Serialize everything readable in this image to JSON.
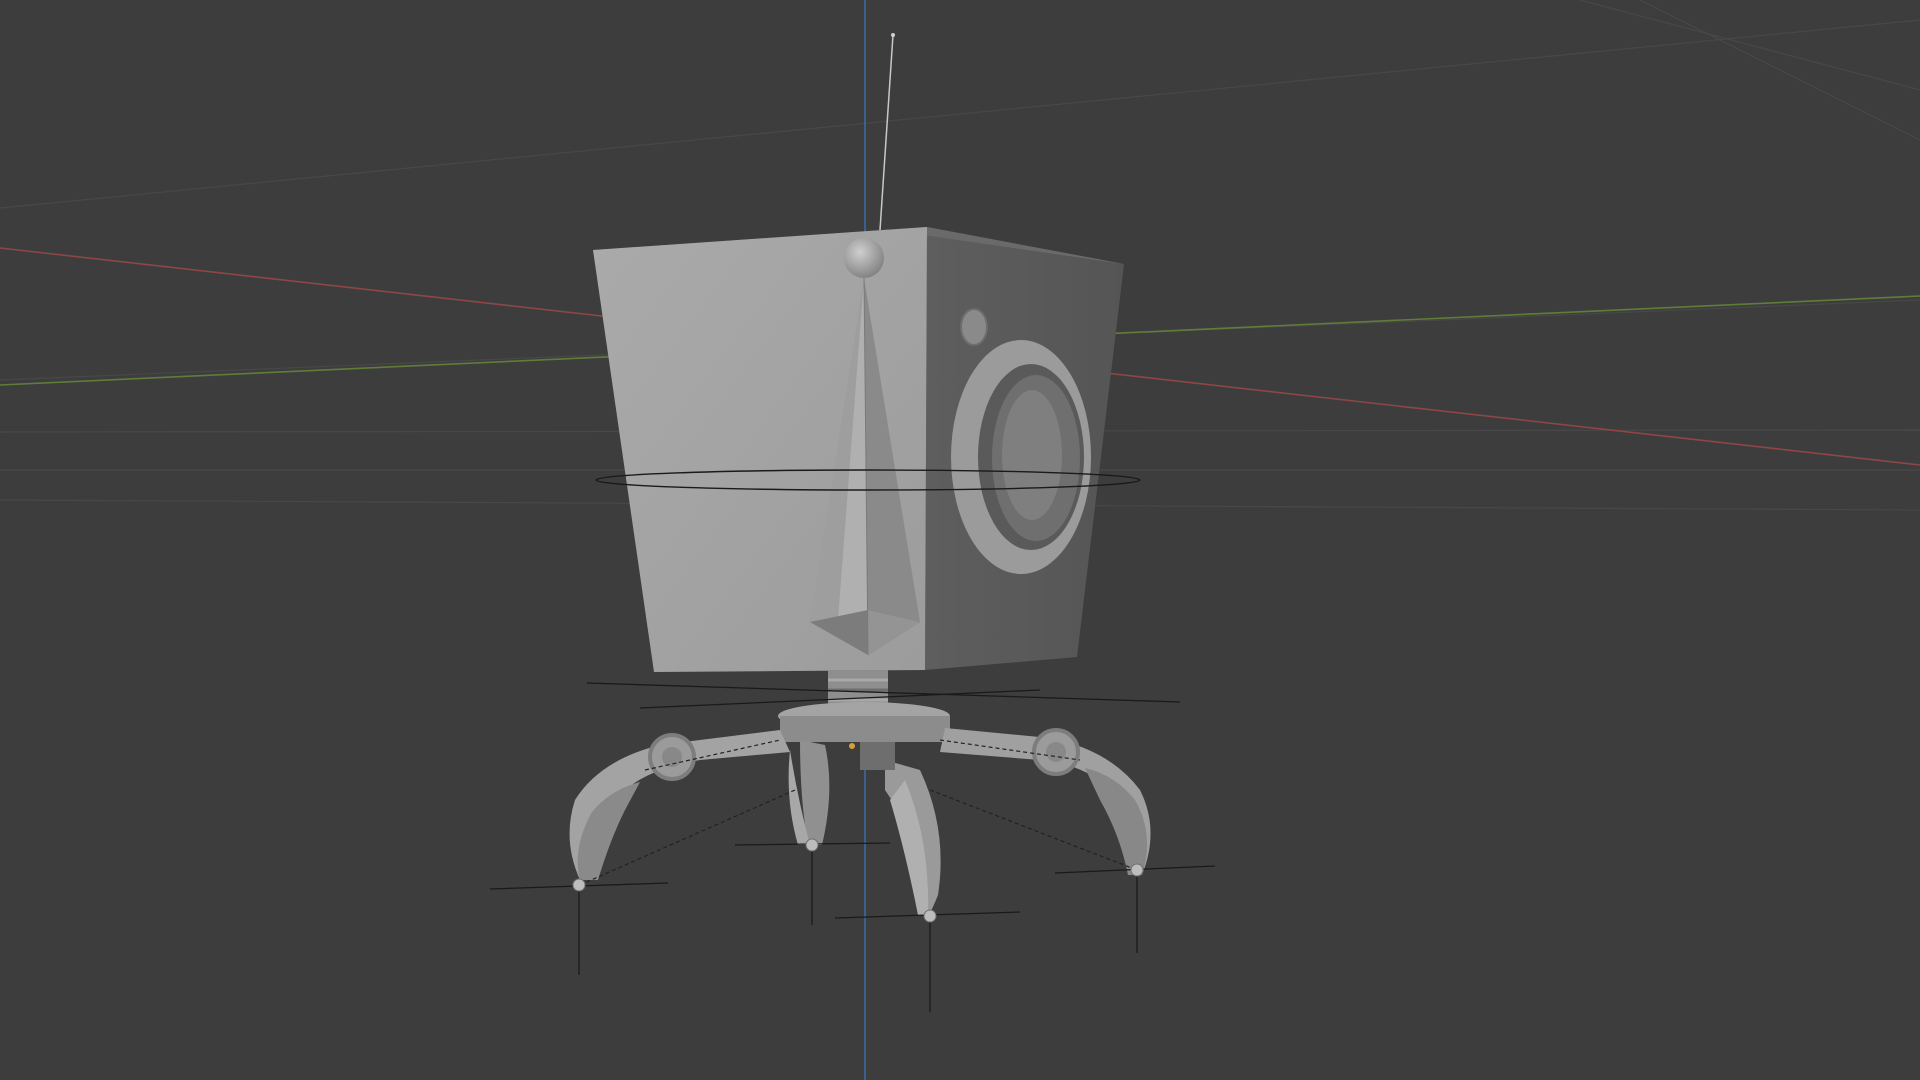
{
  "app": {
    "name": "3D Viewport",
    "background_color": "#3d3d3d",
    "grid_color": "#4a4a4a",
    "x_axis_color": "#9a4a4a",
    "y_axis_color": "#6b8a3e",
    "z_axis_color": "#3f6fa6",
    "model_light_color": "#a7a7a7",
    "model_mid_color": "#8f8f8f",
    "model_dark_color": "#5c5c5c"
  },
  "scene": {
    "objects": [
      {
        "name": "robot-head-box",
        "icon": "cube-icon"
      },
      {
        "name": "nose-cone",
        "icon": "cone-icon"
      },
      {
        "name": "side-eye-ring",
        "icon": "torus-icon"
      },
      {
        "name": "neck-spring",
        "icon": "spring-icon"
      },
      {
        "name": "base-disc",
        "icon": "cylinder-icon"
      },
      {
        "name": "leg-front-left",
        "icon": "bone-icon"
      },
      {
        "name": "leg-front-right",
        "icon": "bone-icon"
      },
      {
        "name": "leg-back-left",
        "icon": "bone-icon"
      },
      {
        "name": "leg-back-right",
        "icon": "bone-icon"
      },
      {
        "name": "antenna",
        "icon": "line-icon"
      }
    ]
  }
}
